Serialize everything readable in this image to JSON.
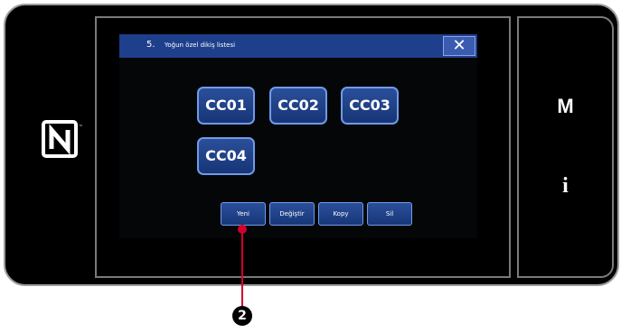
{
  "dialog": {
    "number": "5.",
    "title": "Yoğun özel dikiş listesi",
    "close_label": "✕"
  },
  "patterns": [
    {
      "label": "CC01"
    },
    {
      "label": "CC02"
    },
    {
      "label": "CC03"
    },
    {
      "label": "CC04"
    }
  ],
  "actions": {
    "new_label": "Yeni",
    "edit_label": "Değiştir",
    "copy_label": "Kopy",
    "delete_label": "Sil"
  },
  "side": {
    "menu_label": "M",
    "info_label": "i"
  },
  "callout": {
    "number": "2"
  },
  "colors": {
    "titlebar": "#1e3f8c",
    "button": "#173577",
    "button_border": "#6f9be8",
    "callout": "#d4002a"
  },
  "icons": {
    "nfc": "nfc-icon",
    "close": "close-icon"
  }
}
